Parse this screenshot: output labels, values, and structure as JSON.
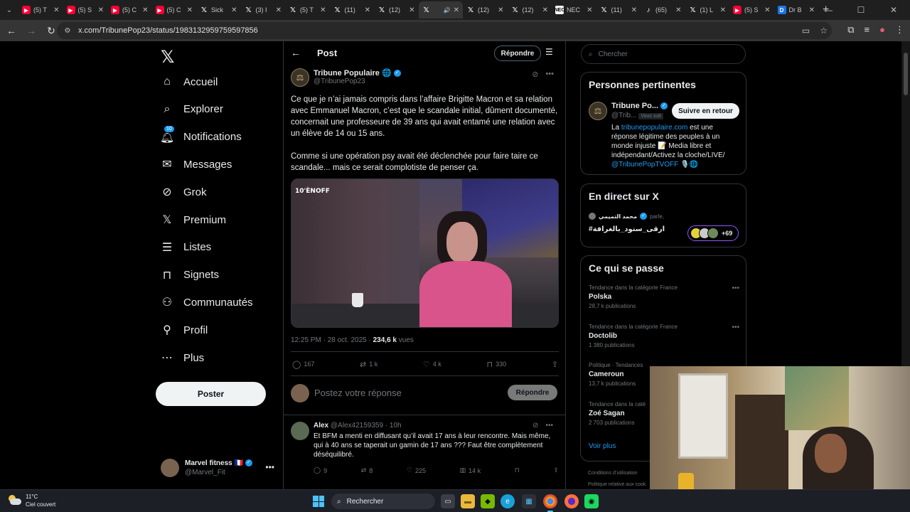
{
  "browser": {
    "tabs": [
      {
        "icon": "youtube",
        "label": "(5) T"
      },
      {
        "icon": "youtube",
        "label": "(5) S"
      },
      {
        "icon": "youtube",
        "label": "(5) C"
      },
      {
        "icon": "youtube",
        "label": "(5) C"
      },
      {
        "icon": "x",
        "label": "Sick"
      },
      {
        "icon": "x",
        "label": "(3) I"
      },
      {
        "icon": "x",
        "label": "(5) T"
      },
      {
        "icon": "x",
        "label": "(11)"
      },
      {
        "icon": "x",
        "label": "(12)"
      },
      {
        "icon": "x",
        "label": ""
      },
      {
        "icon": "x",
        "label": "(12)"
      },
      {
        "icon": "x",
        "label": "(12)"
      },
      {
        "icon": "nec",
        "label": "NEC"
      },
      {
        "icon": "x",
        "label": "(11)"
      },
      {
        "icon": "tiktok",
        "label": "(65)"
      },
      {
        "icon": "x",
        "label": "(1) L"
      },
      {
        "icon": "youtube",
        "label": "(5) S"
      },
      {
        "icon": "d",
        "label": "Dr B"
      }
    ],
    "url": "x.com/TribunePop23/status/1983132959759597856"
  },
  "nav": {
    "items": [
      {
        "icon": "home-icon",
        "label": "Accueil"
      },
      {
        "icon": "search-icon",
        "label": "Explorer"
      },
      {
        "icon": "bell-icon",
        "label": "Notifications",
        "badge": "10"
      },
      {
        "icon": "mail-icon",
        "label": "Messages"
      },
      {
        "icon": "grok-icon",
        "label": "Grok"
      },
      {
        "icon": "x-icon",
        "label": "Premium"
      },
      {
        "icon": "list-icon",
        "label": "Listes"
      },
      {
        "icon": "bookmark-icon",
        "label": "Signets"
      },
      {
        "icon": "people-icon",
        "label": "Communautés"
      },
      {
        "icon": "person-icon",
        "label": "Profil"
      },
      {
        "icon": "more-icon",
        "label": "Plus"
      }
    ],
    "post_button": "Poster",
    "account": {
      "name": "Marvel fitness",
      "flag": "🇫🇷",
      "handle": "@Marvel_Fit"
    }
  },
  "main": {
    "header_title": "Post",
    "reply_pill": "Répondre",
    "tweet": {
      "author_name": "Tribune Populaire",
      "author_handle": "@TribunePop23",
      "paragraph1": "Ce que je n’ai jamais compris dans l’affaire Brigitte Macron et sa relation avec Emmanuel Macron, c’est que le scandale initial, dûment documenté, concernait une professeure de 39 ans qui avait entamé une relation avec un élève de 14 ou 15 ans.",
      "paragraph2": "Comme si une opération psy avait été déclenchée pour faire taire ce scandale... mais ce serait complotiste de penser ça.",
      "media_tag": "10'ÈNOFF",
      "time": "12:25 PM · 28 oct. 2025 · ",
      "views_count": "234,6 k",
      "views_label": " vues",
      "replies": "167",
      "retweets": "1 k",
      "likes": "4 k",
      "bookmarks": "330"
    },
    "reply_box": {
      "placeholder": "Postez votre réponse",
      "button": "Répondre"
    },
    "reply": {
      "name": "Alex",
      "handle": "@Alex42159359",
      "time": " · 10h",
      "text": "Et BFM a menti en diffusant qu’il avait 17 ans à leur rencontre. Mais même, qui à 40 ans se taperait un gamin de 17 ans ??? Faut être complètement déséquilibré.",
      "replies": "9",
      "retweets": "8",
      "likes": "225",
      "views": "14 k"
    }
  },
  "right": {
    "search_placeholder": "Chercher",
    "relevant": {
      "title": "Personnes pertinentes",
      "name": "Tribune Po...",
      "handle": "@Trib...",
      "follows_you": "Vous suit",
      "follow_back": "Suivre en retour",
      "bio_prefix": "La ",
      "bio_link": "tribunepopulaire.com",
      "bio_rest": " est une réponse légitime des peuples à un monde injuste 📝 Media libre et indépendant/Activez la cloche/LIVE/ ",
      "bio_handle": "@TribunePopTVOFF",
      "bio_end": " 🎙️🌐"
    },
    "live": {
      "title": "En direct sur X",
      "host": "محمد التميمي",
      "action": "parle,",
      "tag": "#ارقى_سنود_بالغرافة",
      "count": "+69"
    },
    "trends": {
      "title": "Ce qui se passe",
      "items": [
        {
          "category": "Tendance dans la catégorie France",
          "name": "Polska",
          "count": "28,7 k publications"
        },
        {
          "category": "Tendance dans la catégorie France",
          "name": "Doctolib",
          "count": "1 380 publications"
        },
        {
          "category": "Politique · Tendances",
          "name": "Cameroun",
          "count": "13,7 k publications"
        },
        {
          "category": "Tendance dans la caté",
          "name": "Zoé Sagan",
          "count": "2 703 publications"
        }
      ],
      "see_more": "Voir plus"
    },
    "footer": {
      "line1": "Conditions d’utilisation",
      "line2": "Politique relative aux cook"
    }
  },
  "taskbar": {
    "temperature": "11°C",
    "weather": "Ciel couvert",
    "search": "Rechercher"
  },
  "colors": {
    "accent": "#1d9bf0",
    "background": "#000000",
    "border": "#2f3336",
    "muted": "#71767b"
  }
}
